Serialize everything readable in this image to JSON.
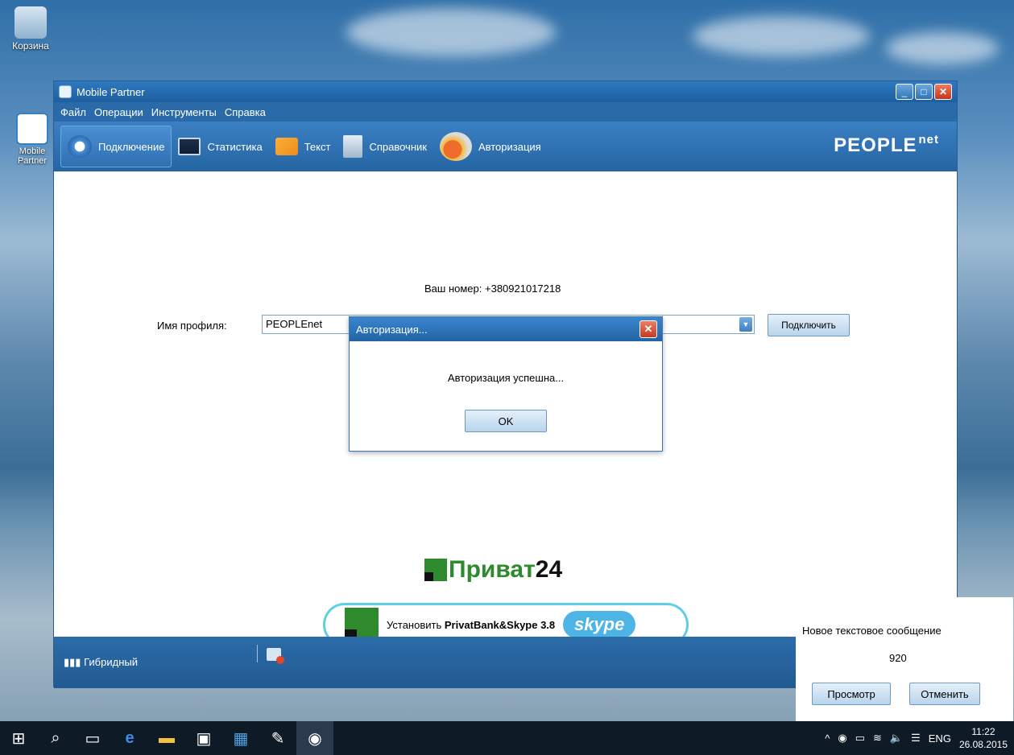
{
  "desktop": {
    "icons": [
      {
        "label": "Корзина"
      },
      {
        "label": "Mobile Partner"
      }
    ]
  },
  "window": {
    "title": "Mobile Partner",
    "menu": [
      "Файл",
      "Операции",
      "Инструменты",
      "Справка"
    ],
    "toolbar": {
      "items": [
        {
          "label": "Подключение",
          "icon": "refresh-icon"
        },
        {
          "label": "Статистика",
          "icon": "stats-icon"
        },
        {
          "label": "Текст",
          "icon": "envelope-icon"
        },
        {
          "label": "Справочник",
          "icon": "contacts-icon"
        },
        {
          "label": "Авторизация",
          "icon": "authorization-icon"
        }
      ],
      "brand_main": "PEOPLE",
      "brand_sup": "net"
    },
    "content": {
      "number_label": "Ваш номер:",
      "number_value": "+380921017218",
      "profile_label": "Имя профиля:",
      "profile_value": "PEOPLEnet",
      "connect_label": "Подключить"
    },
    "dialog": {
      "title": "Авторизация...",
      "message": "Авторизация успешна...",
      "ok_label": "OK"
    },
    "privat": {
      "brand": "Приват",
      "brand_num": "24",
      "banner_prefix": "Установить",
      "banner_bold": "PrivatBank&Skype 3.8",
      "skype_label": "skype"
    },
    "status": {
      "network_mode": "Гибридный"
    }
  },
  "notification": {
    "title": "Новое текстовое сообщение",
    "count": "920",
    "view_label": "Просмотр",
    "cancel_label": "Отменить"
  },
  "taskbar": {
    "language": "ENG",
    "time": "11:22",
    "date": "26.08.2015"
  }
}
